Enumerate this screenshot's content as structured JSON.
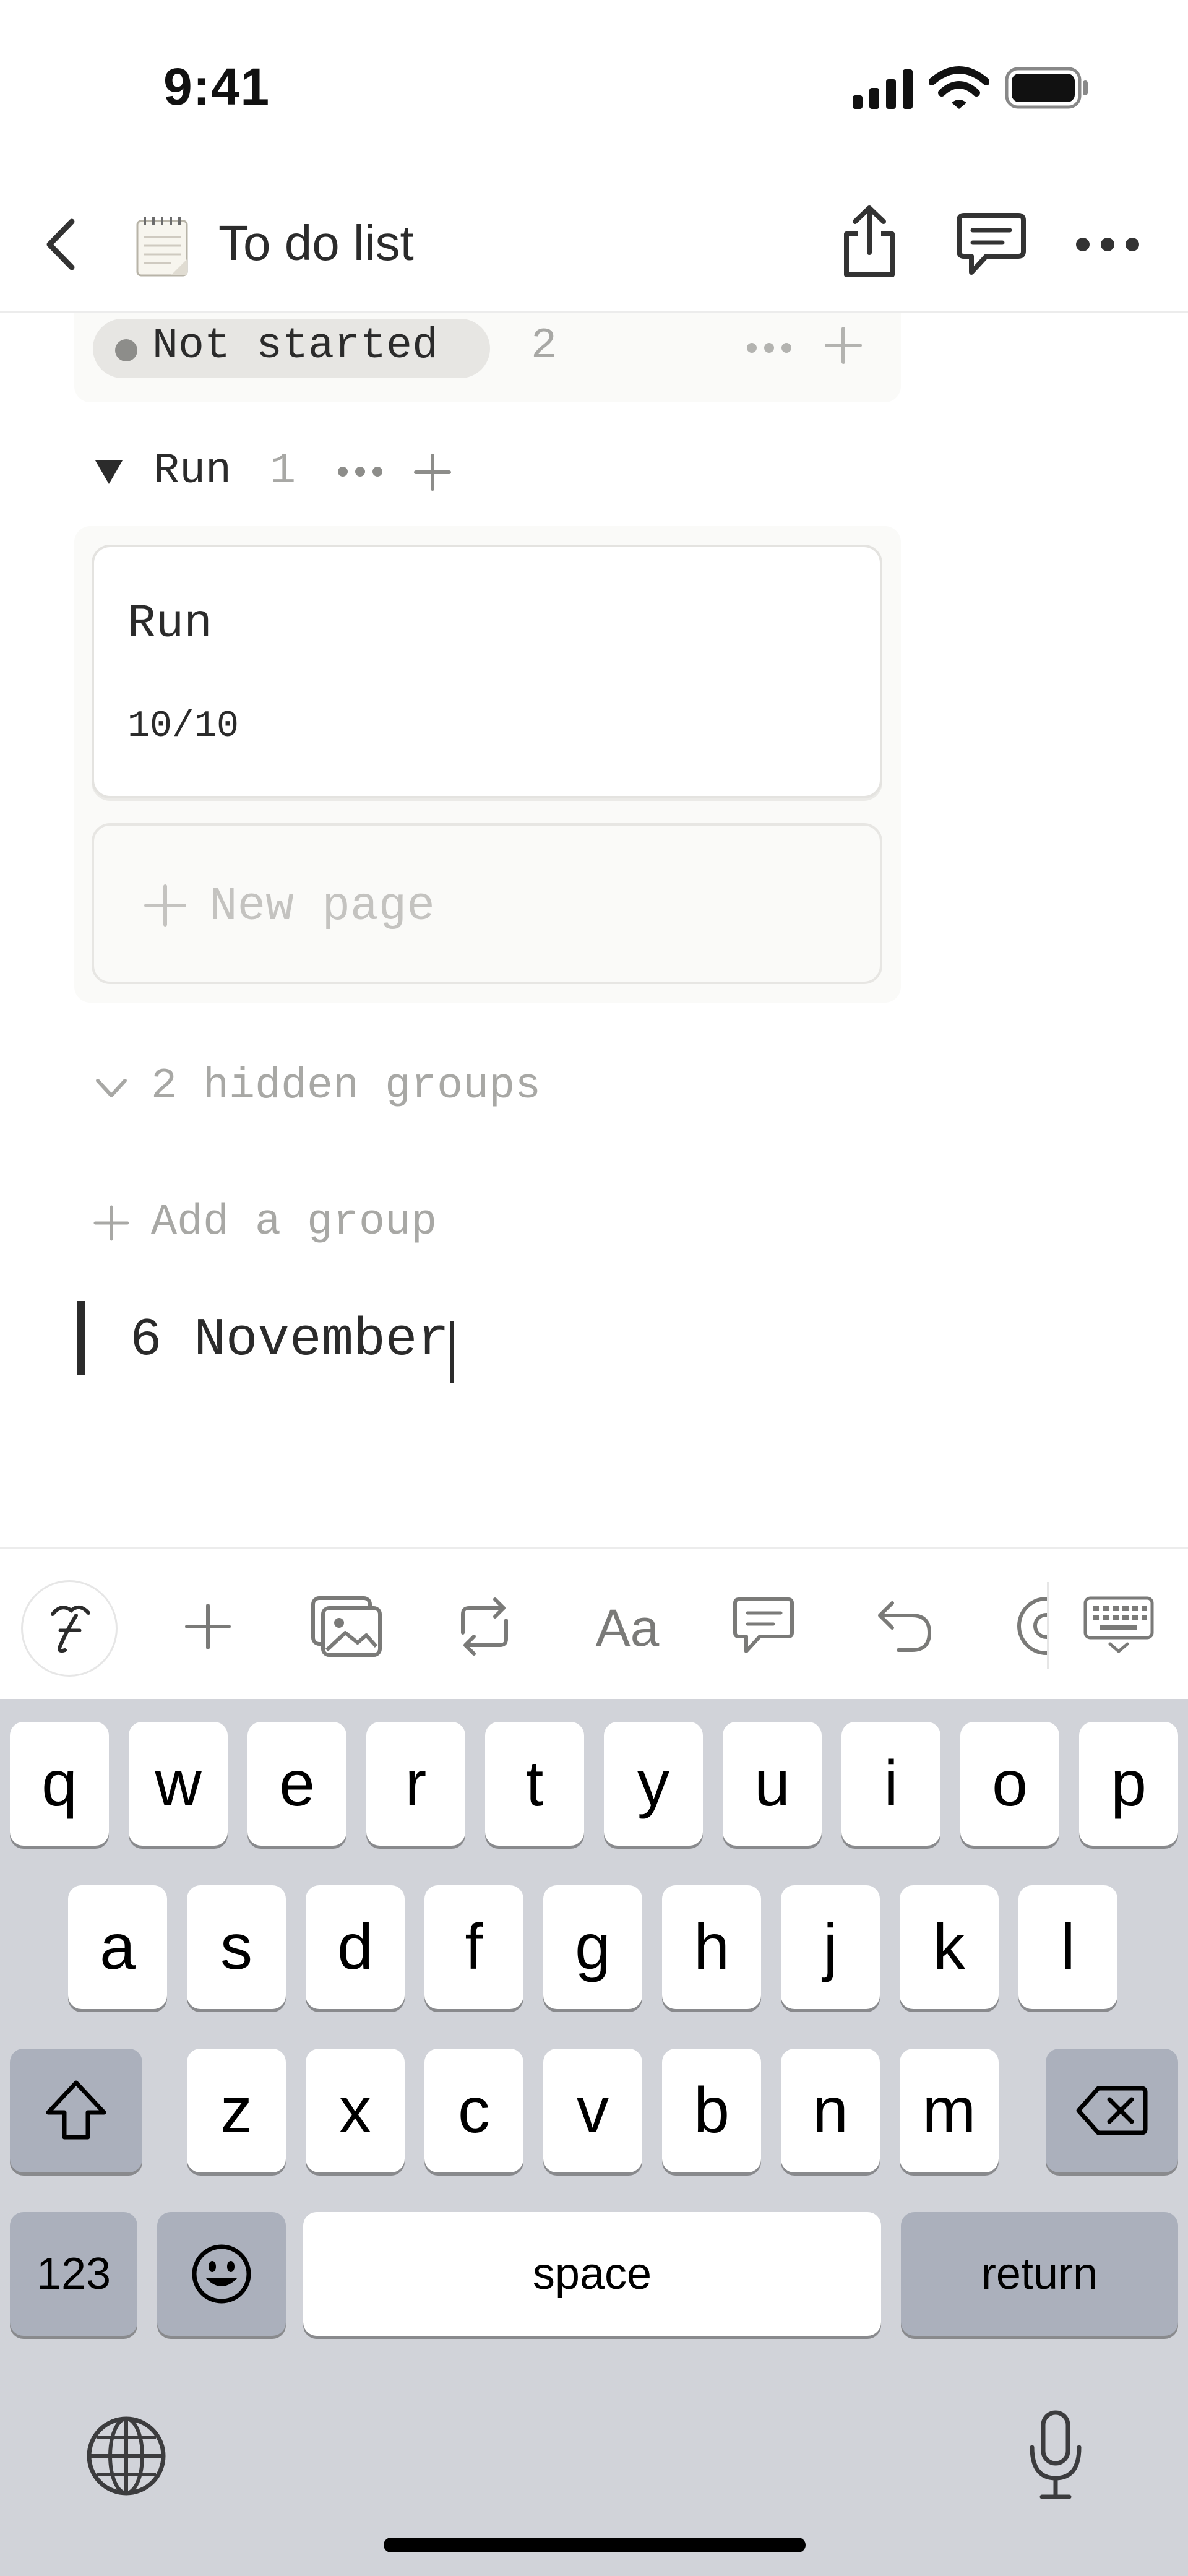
{
  "status_bar": {
    "time": "9:41"
  },
  "nav": {
    "title": "To do list"
  },
  "board": {
    "not_started_group": {
      "label": "Not started",
      "count": "2"
    },
    "run_group": {
      "label": "Run",
      "count": "1"
    },
    "run_card": {
      "title": "Run",
      "date": "10/10"
    },
    "new_page_label": "New page",
    "hidden_groups_label": "2 hidden groups",
    "add_group_label": "Add a group"
  },
  "editor": {
    "text": "6 November"
  },
  "toolbar": {
    "text_style_label": "Aa"
  },
  "keyboard": {
    "row1": [
      "q",
      "w",
      "e",
      "r",
      "t",
      "y",
      "u",
      "i",
      "o",
      "p"
    ],
    "row2": [
      "a",
      "s",
      "d",
      "f",
      "g",
      "h",
      "j",
      "k",
      "l"
    ],
    "row3": [
      "z",
      "x",
      "c",
      "v",
      "b",
      "n",
      "m"
    ],
    "numbers_label": "123",
    "space_label": "space",
    "return_label": "return"
  }
}
